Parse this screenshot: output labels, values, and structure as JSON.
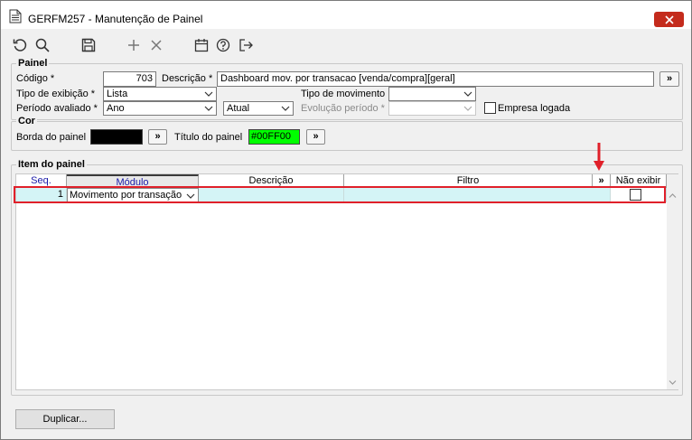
{
  "window": {
    "title": "GERFM257 - Manutenção de Painel"
  },
  "panel": {
    "legend": "Painel",
    "codigo_label": "Código *",
    "codigo_value": "703",
    "descricao_label": "Descrição *",
    "descricao_value": "Dashboard mov. por transacao [venda/compra][geral]",
    "tipo_exibicao_label": "Tipo de exibição *",
    "tipo_exibicao_value": "Lista",
    "tipo_movimento_label": "Tipo de movimento",
    "tipo_movimento_value": "",
    "periodo_label": "Período avaliado *",
    "periodo_value": "Ano",
    "periodo_ref_value": "Atual",
    "evolucao_label": "Evolução período *",
    "evolucao_value": "",
    "empresa_logada_label": "Empresa logada",
    "empresa_logada_checked": false,
    "more_label": "»"
  },
  "cor": {
    "legend": "Cor",
    "borda_label": "Borda do painel",
    "borda_color": "#000000",
    "titulo_label": "Título do painel",
    "titulo_value": "#00FF00",
    "titulo_color": "#00ff00",
    "more_label": "»"
  },
  "item": {
    "legend": "Item do painel",
    "columns": {
      "seq": "Seq.",
      "modulo": "Módulo",
      "descricao": "Descrição",
      "filtro": "Filtro",
      "more": "»",
      "nao_exibir": "Não exibir"
    },
    "rows": [
      {
        "seq": "1",
        "modulo": "Movimento por transação",
        "descricao": "",
        "filtro": "",
        "nao_exibir": false
      }
    ]
  },
  "footer": {
    "duplicar_label": "Duplicar..."
  },
  "colors": {
    "accent_red": "#e0202a",
    "close_red": "#c42b1c",
    "row_highlight": "#d4f4f6",
    "header_blue": "#1a1aa8"
  }
}
